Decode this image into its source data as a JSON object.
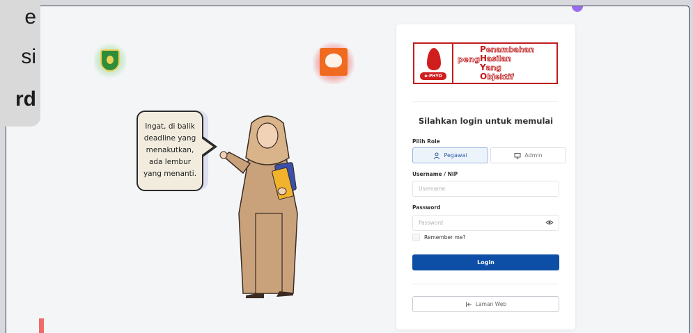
{
  "overlay": {
    "line1": "e",
    "line2": "si",
    "line3": "rd"
  },
  "bubble": {
    "lines": [
      "Ingat, di balik",
      "deadline yang",
      "menakutkan,",
      "ada lembur",
      "yang menanti."
    ]
  },
  "brand": {
    "prefix": "peng",
    "words": [
      {
        "cap": "P",
        "rest": "enambahan"
      },
      {
        "cap": "H",
        "rest": "asilan"
      },
      {
        "cap": "Y",
        "rest": "ang"
      },
      {
        "cap": "O",
        "rest": "bjektif"
      }
    ],
    "badge": "e-PHYO"
  },
  "login": {
    "title": "Silahkan login untuk memulai",
    "role_label": "Pilih Role",
    "roles": {
      "pegawai": "Pegawai",
      "admin": "Admin"
    },
    "username_label": "Username / NIP",
    "username_placeholder": "Username",
    "password_label": "Password",
    "password_placeholder": "Password",
    "remember": "Remember me?",
    "login_button": "Login",
    "web_button": "Laman Web"
  },
  "colors": {
    "primary": "#0d4ea6",
    "brand_red": "#c01c1c",
    "accent_purple": "#9b6cf0",
    "bar_red": "#f26a6a"
  },
  "icons": {
    "pegawai": "user-icon",
    "admin": "monitor-icon",
    "password_toggle": "eye-icon",
    "web": "arrow-left-bar-icon"
  }
}
